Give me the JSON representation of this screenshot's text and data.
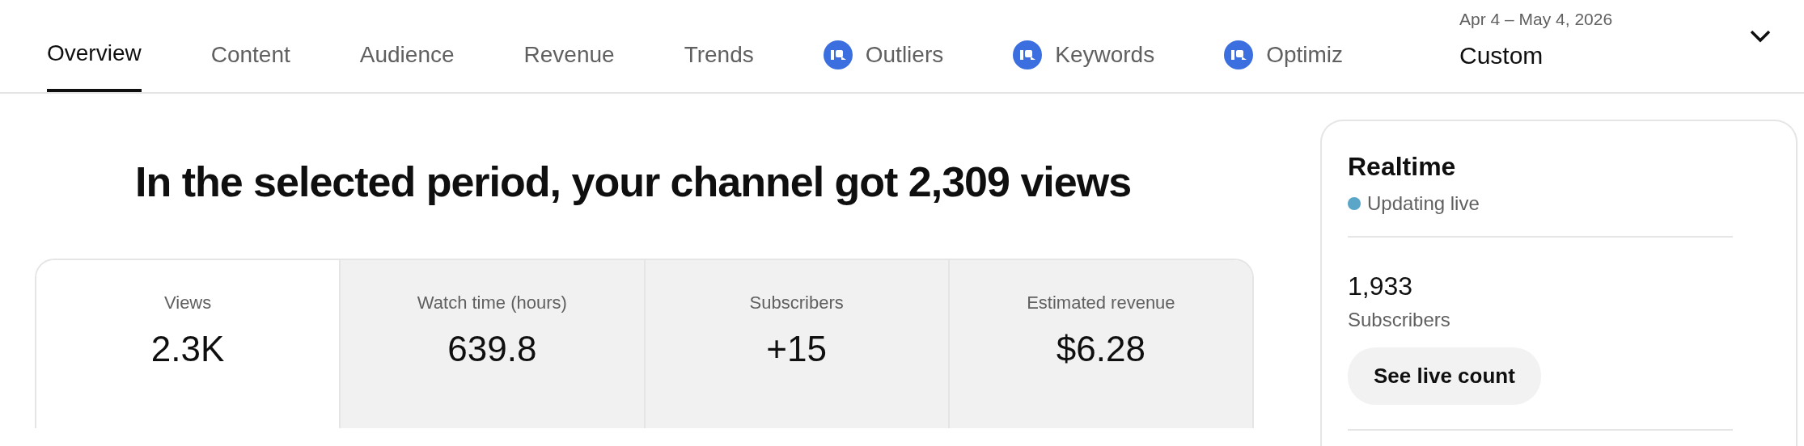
{
  "tabs": [
    {
      "label": "Overview",
      "selected": true,
      "kind": "plain"
    },
    {
      "label": "Content",
      "selected": false,
      "kind": "plain"
    },
    {
      "label": "Audience",
      "selected": false,
      "kind": "plain"
    },
    {
      "label": "Revenue",
      "selected": false,
      "kind": "plain"
    },
    {
      "label": "Trends",
      "selected": false,
      "kind": "plain"
    },
    {
      "label": "Outliers",
      "selected": false,
      "kind": "extension"
    },
    {
      "label": "Keywords",
      "selected": false,
      "kind": "extension"
    },
    {
      "label": "Optimiz",
      "selected": false,
      "kind": "extension"
    }
  ],
  "date_range": {
    "dates": "Apr 4 – May 4, 2026",
    "value": "Custom"
  },
  "headline": "In the selected period, your channel got 2,309 views",
  "metrics": [
    {
      "label": "Views",
      "value": "2.3K",
      "selected": true
    },
    {
      "label": "Watch time (hours)",
      "value": "639.8",
      "selected": false
    },
    {
      "label": "Subscribers",
      "value": "+15",
      "selected": false
    },
    {
      "label": "Estimated revenue",
      "value": "$6.28",
      "selected": false
    }
  ],
  "realtime": {
    "title": "Realtime",
    "status": "Updating live",
    "color": "#5aa5c8",
    "count": "1,933",
    "count_label": "Subscribers",
    "button": "See live count"
  }
}
